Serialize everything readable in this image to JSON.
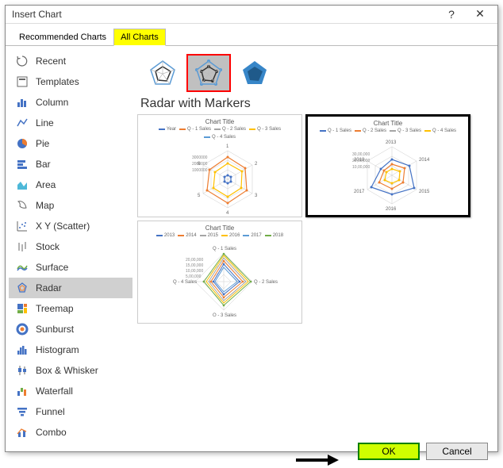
{
  "titlebar": {
    "title": "Insert Chart",
    "help": "?",
    "close": "✕"
  },
  "tabs": {
    "recommended": "Recommended Charts",
    "all": "All Charts"
  },
  "sidebar": {
    "items": [
      {
        "label": "Recent"
      },
      {
        "label": "Templates"
      },
      {
        "label": "Column"
      },
      {
        "label": "Line"
      },
      {
        "label": "Pie"
      },
      {
        "label": "Bar"
      },
      {
        "label": "Area"
      },
      {
        "label": "Map"
      },
      {
        "label": "X Y (Scatter)"
      },
      {
        "label": "Stock"
      },
      {
        "label": "Surface"
      },
      {
        "label": "Radar"
      },
      {
        "label": "Treemap"
      },
      {
        "label": "Sunburst"
      },
      {
        "label": "Histogram"
      },
      {
        "label": "Box & Whisker"
      },
      {
        "label": "Waterfall"
      },
      {
        "label": "Funnel"
      },
      {
        "label": "Combo"
      }
    ]
  },
  "subtitle": "Radar with Markers",
  "previews": {
    "p1": {
      "title": "Chart Title",
      "legend": [
        "Year",
        "Q - 1 Sales",
        "Q - 2 Sales",
        "Q - 3 Sales",
        "Q - 4 Sales"
      ],
      "axis": [
        "1",
        "2",
        "3",
        "4",
        "5",
        "6"
      ],
      "ticks": [
        "3000000",
        "2000000",
        "1000000"
      ]
    },
    "p2": {
      "title": "Chart Title",
      "legend": [
        "Q - 1 Sales",
        "Q - 2 Sales",
        "Q - 3 Sales",
        "Q - 4 Sales"
      ],
      "axis": [
        "2013",
        "2014",
        "2015",
        "2016",
        "2017",
        "2018"
      ],
      "ticks": [
        "30,00,000",
        "20,00,000",
        "10,00,000"
      ]
    },
    "p3": {
      "title": "Chart Title",
      "legend": [
        "2013",
        "2014",
        "2015",
        "2016",
        "2017",
        "2018"
      ],
      "axis": [
        "Q - 1 Sales",
        "Q - 2 Sales",
        "Q - 3 Sales",
        "Q - 4 Sales"
      ],
      "ticks": [
        "20,00,000",
        "15,00,000",
        "10,00,000",
        "5,00,000"
      ]
    }
  },
  "footer": {
    "ok": "OK",
    "cancel": "Cancel"
  },
  "colors": {
    "s1": "#4472c4",
    "s2": "#ed7d31",
    "s3": "#a5a5a5",
    "s4": "#ffc000",
    "s5": "#5b9bd5",
    "s6": "#70ad47"
  }
}
